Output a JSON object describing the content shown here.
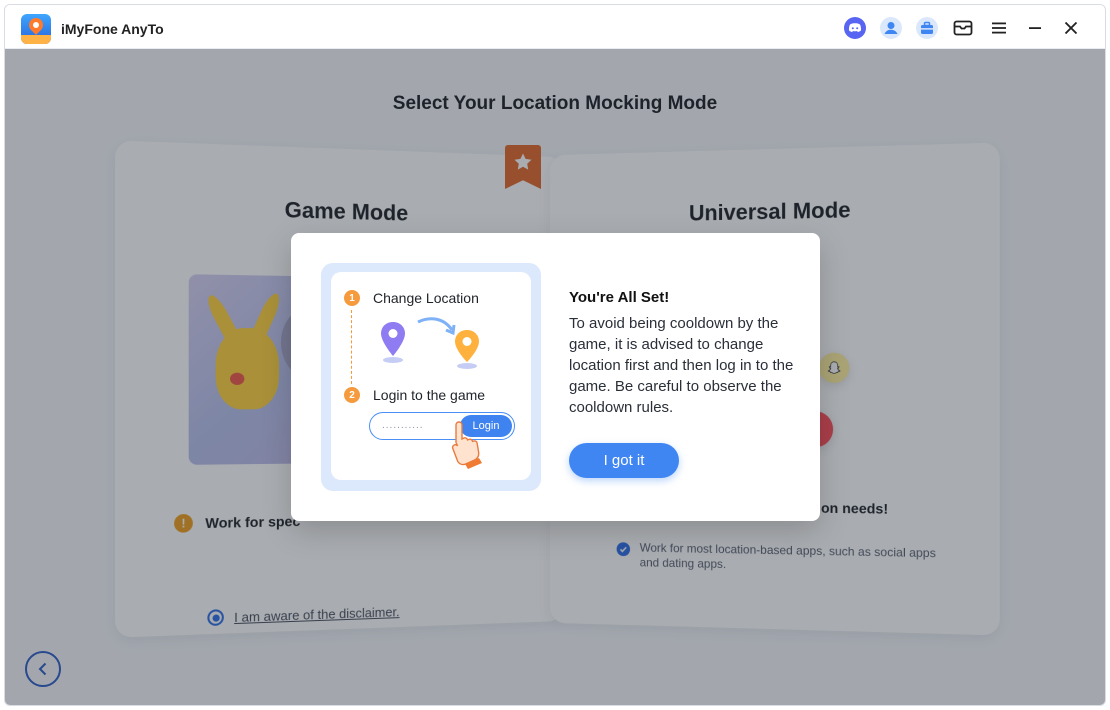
{
  "window": {
    "title": "iMyFone AnyTo"
  },
  "titlebar": {
    "icons": [
      "discord-icon",
      "account-icon",
      "toolbox-icon",
      "mail-icon",
      "menu-icon",
      "minimize-icon",
      "close-icon"
    ]
  },
  "page": {
    "title": "Select Your Location Mocking Mode"
  },
  "game_mode": {
    "title": "Game Mode",
    "warning_text": "Work for spec",
    "disclaimer": "I am aware of the disclaimer."
  },
  "universal_mode": {
    "title": "Universal Mode",
    "heading_fragment": "on needs!",
    "check_text": "Work for most location-based apps, such as social apps and dating apps."
  },
  "modal": {
    "step1": {
      "number": "1",
      "label": "Change Location"
    },
    "step2": {
      "number": "2",
      "label": "Login to the game"
    },
    "login_placeholder": "...........",
    "login_button": "Login",
    "heading": "You're All Set!",
    "body": "To avoid being cooldown by the game, it is advised to change location first and then log in to the game. Be careful to observe the cooldown rules.",
    "confirm_button": "I got it"
  },
  "colors": {
    "accent": "#3f86f2",
    "step_orange": "#f59a3d",
    "ribbon": "#e2692e"
  }
}
